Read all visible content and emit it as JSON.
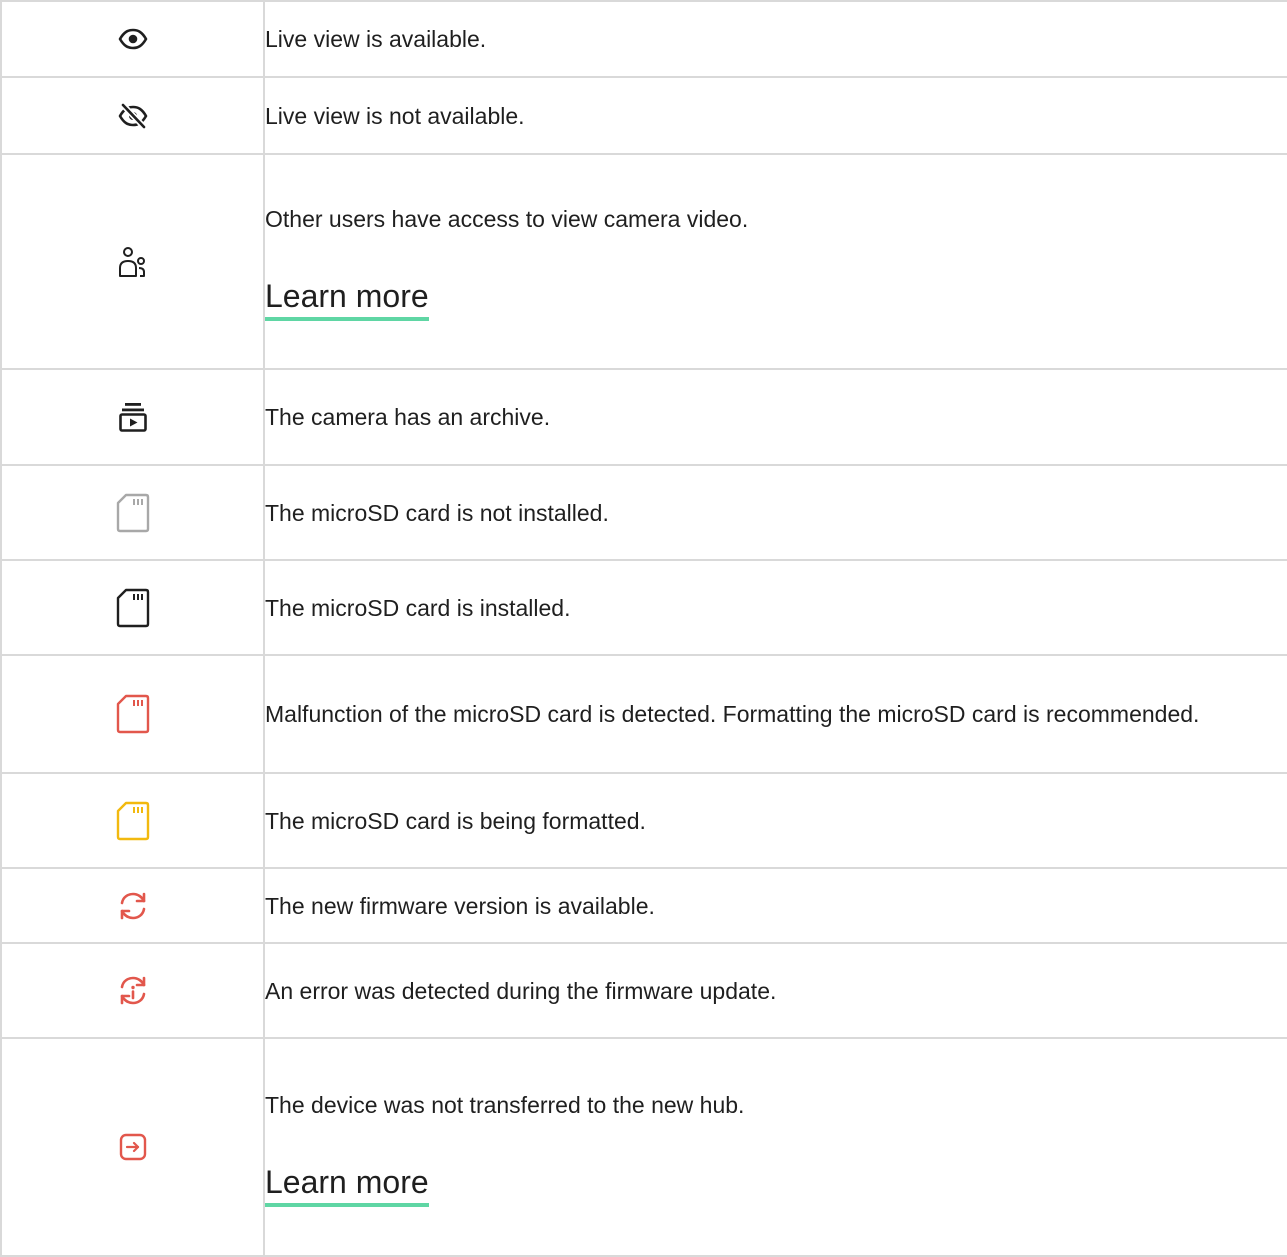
{
  "colors": {
    "border": "#d9d9d9",
    "text": "#1f1f1f",
    "link_underline": "#5fd6a4",
    "red": "#e2574c",
    "yellow": "#f2b90f",
    "gray": "#a8a8a8",
    "black": "#1f1f1f"
  },
  "rows": [
    {
      "icon": "eye-icon",
      "text": "Live view is available."
    },
    {
      "icon": "eye-off-icon",
      "text": "Live view is not available."
    },
    {
      "icon": "users-icon",
      "text": "Other users have access to view camera video.",
      "link": "Learn more"
    },
    {
      "icon": "archive-icon",
      "text": "The camera has an archive."
    },
    {
      "icon": "sd-card-gray-icon",
      "text": "The microSD card is not installed."
    },
    {
      "icon": "sd-card-black-icon",
      "text": "The microSD card is installed."
    },
    {
      "icon": "sd-card-red-icon",
      "text": "Malfunction of the microSD card is detected. Formatting the microSD card is recommended."
    },
    {
      "icon": "sd-card-yellow-icon",
      "text": "The microSD card is being formatted."
    },
    {
      "icon": "refresh-icon",
      "text": "The new firmware version is available."
    },
    {
      "icon": "update-error-icon",
      "text": "An error was detected during the firmware update."
    },
    {
      "icon": "transfer-icon",
      "text": "The device was not transferred to the new hub.",
      "link": "Learn more"
    }
  ]
}
